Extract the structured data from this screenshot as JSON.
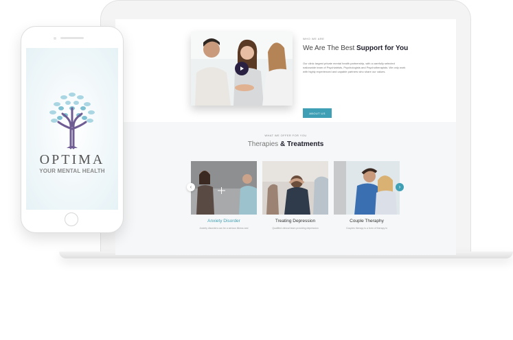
{
  "phone": {
    "brand": "OPTIMA",
    "tagline": "YOUR MENTAL HEALTH"
  },
  "about": {
    "eyebrow": "WHO WE ARE",
    "title_prefix": "We Are The Best",
    "title_bold": "Support for You",
    "body": "Our clinic largest private mental health partnership, with a carefully selected nationwide team of Psychiatrists, Psychologists and Psychotherapists. We only work with highly experienced and capable partners who share our values.",
    "button": "ABOUT US"
  },
  "therapies": {
    "eyebrow": "WHAT WE OFFER FOR YOU",
    "title_prefix": "Therapies",
    "title_bold": "& Treatments",
    "cards": [
      {
        "label": "Anxiety Disorder",
        "desc": "Anxiety disorders can be a serious illness and"
      },
      {
        "label": "Treating Depression",
        "desc": "Qualified clinical team providing depression"
      },
      {
        "label": "Couple Theraphy",
        "desc": "Couples therapy is a form of therapy in"
      }
    ]
  },
  "icons": {
    "play": "play-icon",
    "prev": "chevron-left-icon",
    "next": "chevron-right-icon",
    "plus": "plus-icon",
    "tree": "tree-logo-icon"
  },
  "colors": {
    "accent": "#3fa0b5",
    "dark": "#1d1d2b",
    "play_bg": "#2a2142",
    "tree_trunk": "#6f5c93",
    "leaf_light": "#a9d6e2",
    "leaf_mid": "#7fc0d3"
  }
}
